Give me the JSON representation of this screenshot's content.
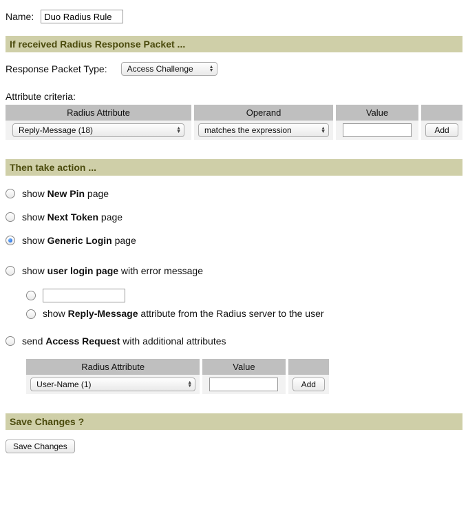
{
  "name": {
    "label": "Name:",
    "value": "Duo Radius Rule"
  },
  "section_condition": "If received Radius Response Packet ...",
  "response_packet": {
    "label": "Response Packet Type:",
    "value": "Access Challenge"
  },
  "attribute_criteria_label": "Attribute criteria:",
  "criteria_table": {
    "headers": {
      "attr": "Radius Attribute",
      "operand": "Operand",
      "value": "Value"
    },
    "row": {
      "attr": "Reply-Message (18)",
      "operand": "matches the expression",
      "value": ""
    },
    "add_label": "Add"
  },
  "section_action": "Then take action ...",
  "actions": {
    "new_pin": {
      "prefix": "show ",
      "bold": "New Pin",
      "suffix": " page"
    },
    "next_token": {
      "prefix": "show ",
      "bold": "Next Token",
      "suffix": " page"
    },
    "generic": {
      "prefix": "show ",
      "bold": "Generic Login",
      "suffix": " page"
    },
    "user_login": {
      "prefix": "show ",
      "bold": "user login page",
      "suffix": " with error message"
    },
    "reply_msg": {
      "prefix": "show ",
      "bold": "Reply-Message",
      "suffix": " attribute from the Radius server to the user"
    },
    "access_req": {
      "prefix": "send ",
      "bold": "Access Request",
      "suffix": " with additional attributes"
    }
  },
  "error_input_value": "",
  "attrs_table": {
    "headers": {
      "attr": "Radius Attribute",
      "value": "Value"
    },
    "row": {
      "attr": "User-Name (1)",
      "value": ""
    },
    "add_label": "Add"
  },
  "section_save": "Save Changes ?",
  "save_button": "Save Changes"
}
